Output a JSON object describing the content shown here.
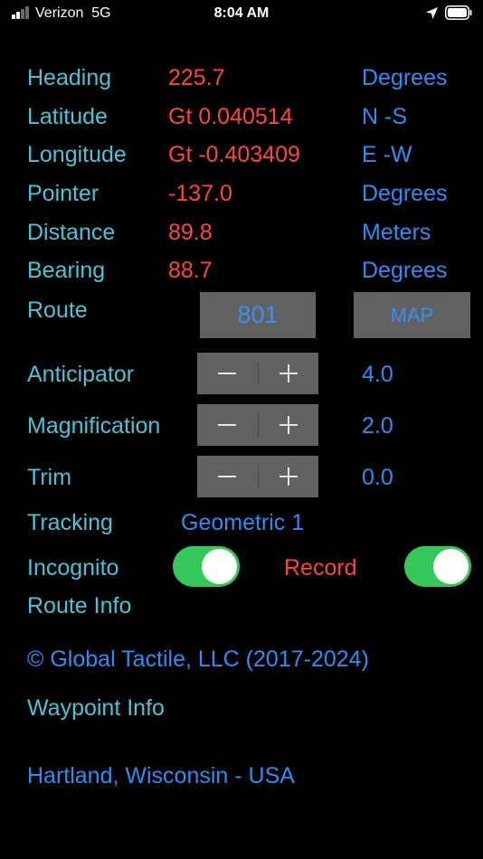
{
  "status_bar": {
    "carrier": "Verizon",
    "network": "5G",
    "time": "8:04 AM",
    "signal_bars": 2,
    "icons": [
      "signal-bars-icon",
      "location-arrow-icon",
      "battery-icon"
    ]
  },
  "readouts": [
    {
      "label": "Heading",
      "value": "225.7",
      "unit": "Degrees"
    },
    {
      "label": "Latitude",
      "value": "Gt 0.040514",
      "unit": "N -S"
    },
    {
      "label": "Longitude",
      "value": "Gt -0.403409",
      "unit": "E -W"
    },
    {
      "label": "Pointer",
      "value": "-137.0",
      "unit": "Degrees"
    },
    {
      "label": "Distance",
      "value": "89.8",
      "unit": "Meters"
    },
    {
      "label": "Bearing",
      "value": "88.7",
      "unit": "Degrees"
    }
  ],
  "route": {
    "label": "Route",
    "number": "801",
    "map_label": "MAP"
  },
  "steppers": [
    {
      "label": "Anticipator",
      "minus": "−",
      "plus": "+",
      "value": "4.0"
    },
    {
      "label": "Magnification",
      "minus": "−",
      "plus": "+",
      "value": "2.0"
    },
    {
      "label": "Trim",
      "minus": "−",
      "plus": "+",
      "value": "0.0"
    }
  ],
  "tracking": {
    "label": "Tracking",
    "mode": "Geometric 1"
  },
  "incognito": {
    "label": "Incognito",
    "on": true
  },
  "record": {
    "label": "Record",
    "on": true
  },
  "route_info_label": "Route Info",
  "copyright": "© Global Tactile, LLC (2017-2024)",
  "waypoint_info_label": "Waypoint Info",
  "location": "Hartland, Wisconsin - USA",
  "colors": {
    "label_teal": "#4ec2d6",
    "value_red": "#ff453a",
    "unit_blue": "#2f8cf2",
    "button_gray": "#616161",
    "toggle_green": "#34c759"
  }
}
